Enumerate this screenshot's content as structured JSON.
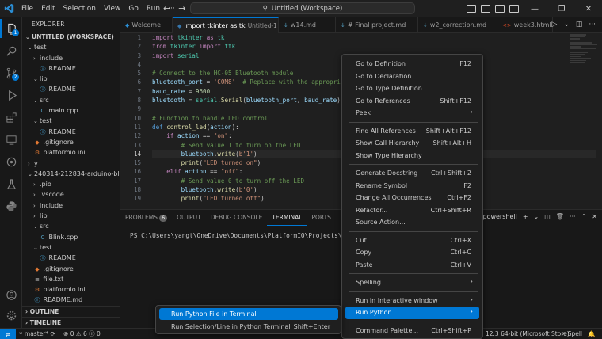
{
  "window": {
    "title": "Untitled (Workspace)",
    "menus": [
      "File",
      "Edit",
      "Selection",
      "View",
      "Go",
      "Run",
      "···"
    ]
  },
  "activity": {
    "explorer_badge": "1",
    "scm_badge": "2"
  },
  "sidebar": {
    "title": "EXPLORER",
    "workspace": "UNTITLED (WORKSPACE)",
    "rows": [
      {
        "label": "test",
        "depth": 1,
        "kind": "folder",
        "open": true
      },
      {
        "label": "include",
        "depth": 2,
        "kind": "folder",
        "open": false
      },
      {
        "label": "README",
        "depth": 3,
        "kind": "info"
      },
      {
        "label": "lib",
        "depth": 2,
        "kind": "folder",
        "open": true
      },
      {
        "label": "README",
        "depth": 3,
        "kind": "info"
      },
      {
        "label": "src",
        "depth": 2,
        "kind": "folder",
        "open": true
      },
      {
        "label": "main.cpp",
        "depth": 3,
        "kind": "cpp"
      },
      {
        "label": "test",
        "depth": 2,
        "kind": "folder",
        "open": true
      },
      {
        "label": "README",
        "depth": 3,
        "kind": "info"
      },
      {
        "label": ".gitignore",
        "depth": 2,
        "kind": "git"
      },
      {
        "label": "platformio.ini",
        "depth": 2,
        "kind": "pio"
      },
      {
        "label": "y",
        "depth": 1,
        "kind": "folder",
        "open": false
      },
      {
        "label": "240314-212834-arduino-blink",
        "depth": 1,
        "kind": "folder",
        "open": true
      },
      {
        "label": ".pio",
        "depth": 2,
        "kind": "folder",
        "open": false
      },
      {
        "label": ".vscode",
        "depth": 2,
        "kind": "folder",
        "open": false
      },
      {
        "label": "include",
        "depth": 2,
        "kind": "folder",
        "open": false
      },
      {
        "label": "lib",
        "depth": 2,
        "kind": "folder",
        "open": false
      },
      {
        "label": "src",
        "depth": 2,
        "kind": "folder",
        "open": true
      },
      {
        "label": "Blink.cpp",
        "depth": 3,
        "kind": "cpp"
      },
      {
        "label": "test",
        "depth": 2,
        "kind": "folder",
        "open": true
      },
      {
        "label": "README",
        "depth": 3,
        "kind": "info"
      },
      {
        "label": ".gitignore",
        "depth": 2,
        "kind": "git"
      },
      {
        "label": "file.txt",
        "depth": 2,
        "kind": "txt"
      },
      {
        "label": "platformio.ini",
        "depth": 2,
        "kind": "pio"
      },
      {
        "label": "README.md",
        "depth": 2,
        "kind": "md"
      }
    ],
    "outline": "OUTLINE",
    "timeline": "TIMELINE"
  },
  "tabs": [
    {
      "label": "Welcome",
      "icon": "vscode-icon",
      "active": false
    },
    {
      "label": "import tkinter as tk",
      "sub": "Untitled-1",
      "icon": "python-icon",
      "active": true,
      "dirty": true
    },
    {
      "label": "w14.md",
      "icon": "markdown-icon",
      "active": false
    },
    {
      "label": "# Final project.md",
      "icon": "markdown-icon",
      "active": false
    },
    {
      "label": "w2_correction.md",
      "icon": "markdown-icon",
      "active": false
    },
    {
      "label": "week3.html",
      "icon": "html-icon",
      "active": false
    }
  ],
  "editor": {
    "current_line": 14,
    "lines": [
      "import tkinter as tk",
      "from tkinter import ttk",
      "import serial",
      "",
      "# Connect to the HC-05 Bluetooth module",
      "bluetooth_port = 'COM8'  # Replace with the appropri",
      "baud_rate = 9600",
      "bluetooth = serial.Serial(bluetooth_port, baud_rate)",
      "",
      "# Function to handle LED control",
      "def control_led(action):",
      "    if action == \"on\":",
      "        # Send value 1 to turn on the LED",
      "        bluetooth.write(b'1')",
      "        print(\"LED turned on\")",
      "    elif action == \"off\":",
      "        # Send value 0 to turn off the LED",
      "        bluetooth.write(b'0')",
      "        print(\"LED turned off\")"
    ]
  },
  "panel": {
    "tabs": [
      "PROBLEMS",
      "OUTPUT",
      "DEBUG CONSOLE",
      "TERMINAL",
      "PORTS",
      "SERIAL M"
    ],
    "problems_count": "6",
    "active_tab": "TERMINAL",
    "terminal_line": "PS C:\\Users\\yangt\\OneDrive\\Documents\\PlatformIO\\Projects\\2403",
    "shell": "powershell"
  },
  "context_menu": {
    "items": [
      {
        "label": "Go to Definition",
        "shortcut": "F12"
      },
      {
        "label": "Go to Declaration",
        "shortcut": ""
      },
      {
        "label": "Go to Type Definition",
        "shortcut": ""
      },
      {
        "label": "Go to References",
        "shortcut": "Shift+F12"
      },
      {
        "label": "Peek",
        "shortcut": "",
        "submenu": true
      },
      {
        "label": "Find All References",
        "shortcut": "Shift+Alt+F12"
      },
      {
        "label": "Show Call Hierarchy",
        "shortcut": "Shift+Alt+H"
      },
      {
        "label": "Show Type Hierarchy",
        "shortcut": ""
      },
      {
        "label": "Generate Docstring",
        "shortcut": "Ctrl+Shift+2"
      },
      {
        "label": "Rename Symbol",
        "shortcut": "F2"
      },
      {
        "label": "Change All Occurrences",
        "shortcut": "Ctrl+F2"
      },
      {
        "label": "Refactor...",
        "shortcut": "Ctrl+Shift+R"
      },
      {
        "label": "Source Action...",
        "shortcut": ""
      },
      {
        "label": "Cut",
        "shortcut": "Ctrl+X"
      },
      {
        "label": "Copy",
        "shortcut": "Ctrl+C"
      },
      {
        "label": "Paste",
        "shortcut": "Ctrl+V"
      },
      {
        "label": "Spelling",
        "shortcut": "",
        "submenu": true
      },
      {
        "label": "Run in Interactive window",
        "shortcut": "",
        "submenu": true
      },
      {
        "label": "Run Python",
        "shortcut": "",
        "submenu": true,
        "highlighted": true
      },
      {
        "label": "Command Palette...",
        "shortcut": "Ctrl+Shift+P"
      }
    ]
  },
  "submenu": {
    "items": [
      {
        "label": "Run Python File in Terminal",
        "shortcut": "",
        "highlighted": true
      },
      {
        "label": "Run Selection/Line in Python Terminal",
        "shortcut": "Shift+Enter"
      }
    ]
  },
  "statusbar": {
    "branch": "master*",
    "sync": "⟳",
    "errors": "0",
    "warnings": "6",
    "info": "0",
    "python": "12.3 64-bit (Microsoft Store)",
    "spell": "Spell"
  }
}
